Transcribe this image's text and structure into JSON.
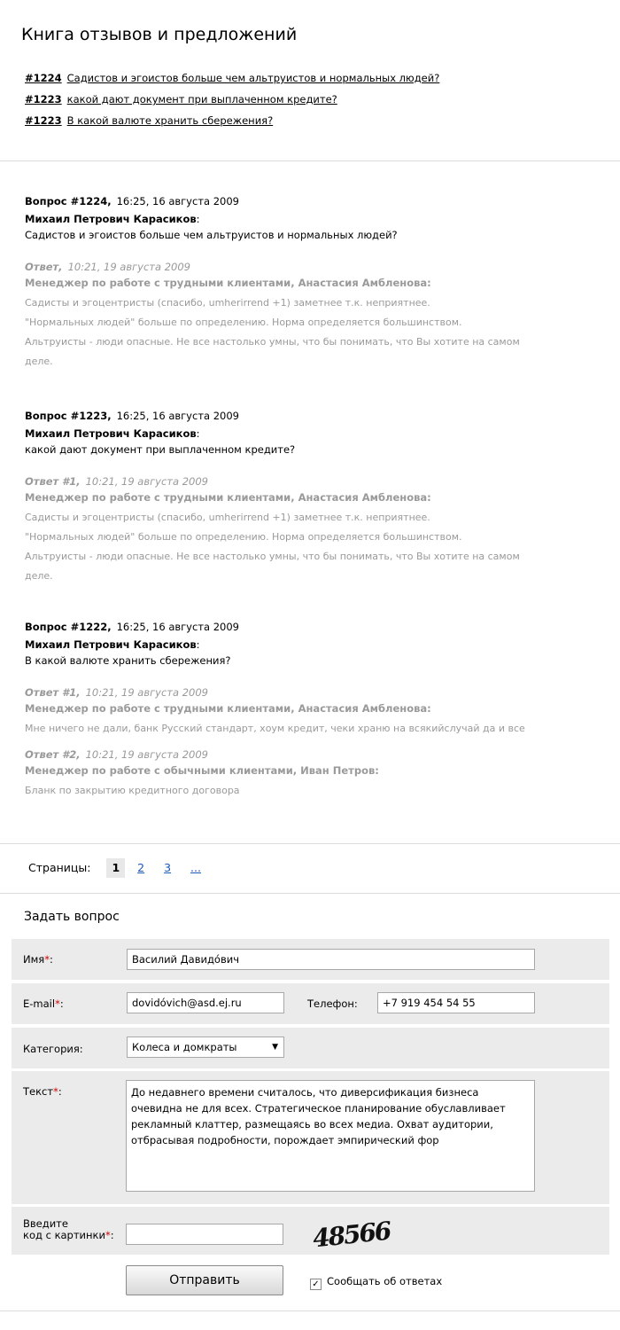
{
  "page_title": "Книга отзывов и предложений",
  "toc": [
    {
      "num": "#1224",
      "text": "Садистов и эгоистов больше чем альтруистов и нормальных людей?"
    },
    {
      "num": "#1223",
      "text": "какой дают документ при выплаченном кредите?"
    },
    {
      "num": "#1223",
      "text": "В какой валюте хранить сбережения?"
    }
  ],
  "questions": [
    {
      "label": "Вопрос #1224,",
      "time": "16:25, 16 августа 2009",
      "author": "Михаил Петрович Карасиков",
      "text": "Садистов и эгоистов больше чем альтруистов и нормальных людей?",
      "answers": [
        {
          "label": "Ответ,",
          "time": "10:21, 19 августа 2009",
          "author": "Менеджер по работе с трудными клиентами, Анастасия Амбленова:",
          "lines": [
            "Садисты и эгоцентристы (спасибо, umherirrend +1) заметнее т.к. неприятнее.",
            "\"Нормальных людей\" больше по определению. Норма определяется большинством.",
            "Альтруисты - люди опасные. Не все настолько умны, что бы понимать, что Вы хотите на самом",
            "деле."
          ]
        }
      ]
    },
    {
      "label": "Вопрос #1223,",
      "time": "16:25, 16 августа 2009",
      "author": "Михаил Петрович Карасиков",
      "text": "какой дают документ при выплаченном кредите?",
      "answers": [
        {
          "label": "Ответ #1,",
          "time": "10:21, 19 августа 2009",
          "author": "Менеджер по работе с трудными клиентами, Анастасия Амбленова:",
          "lines": [
            "Садисты и эгоцентристы (спасибо, umherirrend +1) заметнее т.к. неприятнее.",
            "\"Нормальных людей\" больше по определению. Норма определяется большинством.",
            "Альтруисты - люди опасные. Не все настолько умны, что бы понимать, что Вы хотите на самом",
            "деле."
          ]
        }
      ]
    },
    {
      "label": "Вопрос #1222,",
      "time": "16:25, 16 августа 2009",
      "author": "Михаил Петрович Карасиков",
      "text": "В какой валюте хранить сбережения?",
      "answers": [
        {
          "label": "Ответ #1,",
          "time": "10:21, 19 августа 2009",
          "author": "Менеджер по работе с трудными клиентами, Анастасия Амбленова:",
          "lines": [
            "Мне ничего не дали, банк Русский стандарт, хоум кредит, чеки храню на всякийслучай да и все"
          ]
        },
        {
          "label": "Ответ #2,",
          "time": "10:21, 19 августа 2009",
          "author": "Менеджер по работе с обычными клиентами, Иван Петров:",
          "lines": [
            "Бланк по закрытию кредитного договора"
          ]
        }
      ]
    }
  ],
  "pager": {
    "label": "Страницы:",
    "current": "1",
    "pages": [
      "2",
      "3",
      "..."
    ]
  },
  "form": {
    "title": "Задать вопрос",
    "name_label": "Имя",
    "name_value": "Василий Давидóвич",
    "email_label": "E-mail",
    "email_value": "dovidóvich@asd.ej.ru",
    "phone_label": "Телефон:",
    "phone_value": "+7 919 454 54 55",
    "category_label": "Категория:",
    "category_value": "Колеса и домкраты",
    "text_label": "Текст",
    "text_value": "До недавнего времени считалось, что диверсификация бизнеса очевидна не для всех. Стратегическое планирование обуславливает рекламный клаттер, размещаясь во всех медиа. Охват аудитории, отбрасывая подробности, порождает эмпирический фор",
    "captcha_label_1": "Введите",
    "captcha_label_2": "код с картинки",
    "captcha_value": "",
    "captcha_image_text": "48566",
    "submit_label": "Отправить",
    "notify_label": "Сообщать об ответах",
    "notify_checked": true,
    "required_mark": "*",
    "colon": ":"
  },
  "colors": {
    "required": "#d00000",
    "answer_text": "#9a9a9a",
    "link": "#1a57b8",
    "form_row_bg": "#ebebeb"
  }
}
